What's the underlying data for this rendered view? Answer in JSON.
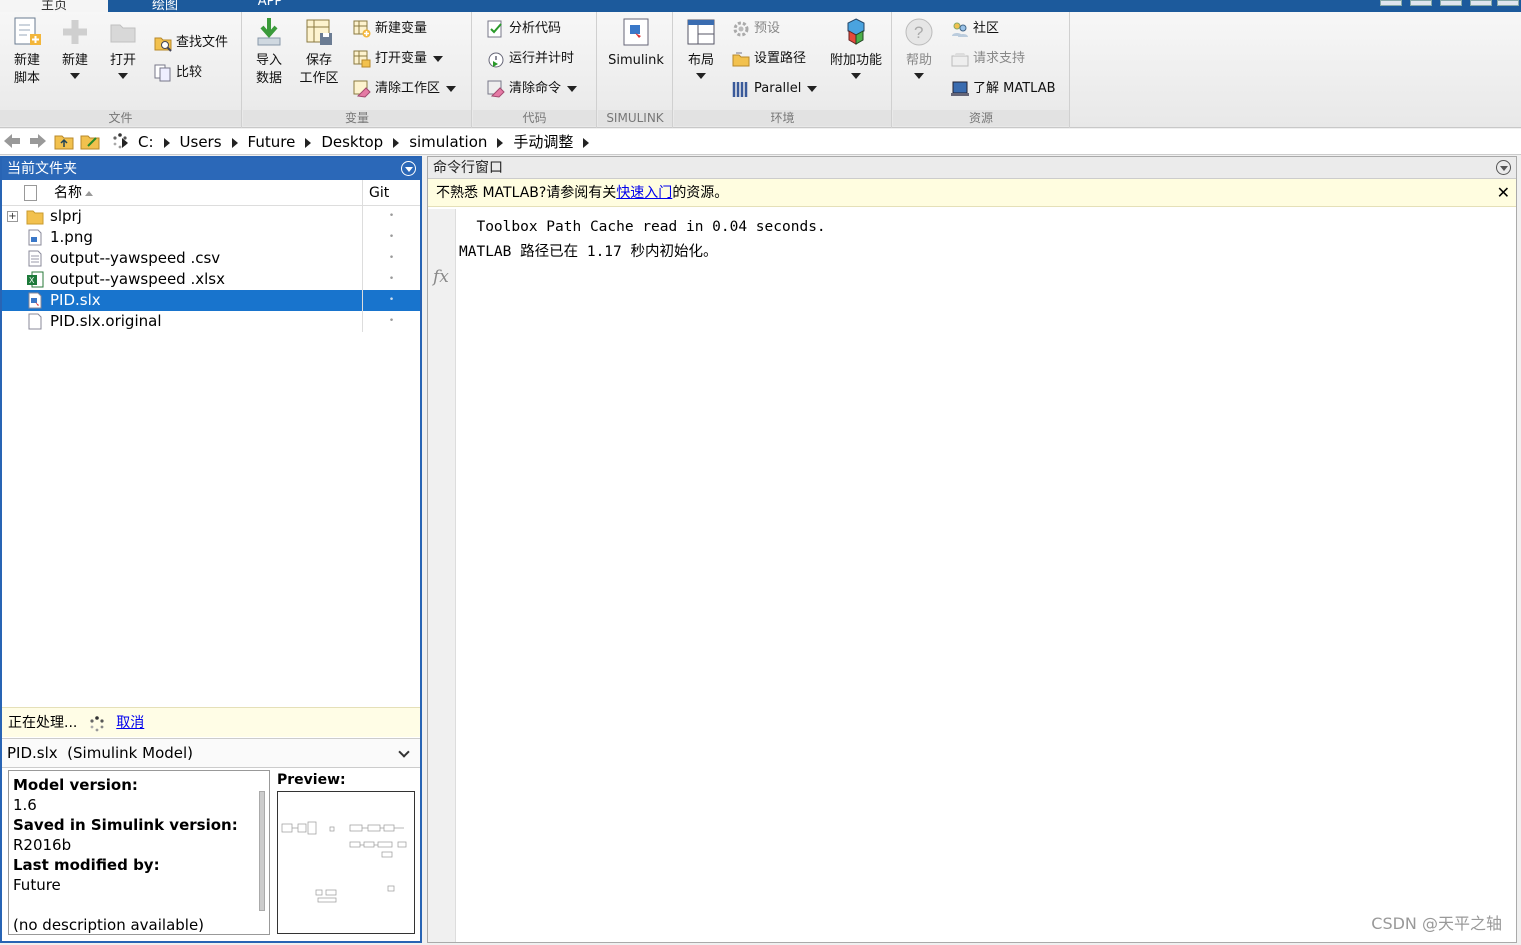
{
  "tabs": [
    {
      "label": "主页",
      "active": true
    },
    {
      "label": "绘图",
      "active": false
    },
    {
      "label": "APP",
      "active": false
    }
  ],
  "ribbon": {
    "file": {
      "label": "文件",
      "new_script": "新建\n脚本",
      "new": "新建",
      "open": "打开",
      "find_files": "查找文件",
      "compare": "比较"
    },
    "variable": {
      "label": "变量",
      "import_data": "导入\n数据",
      "save_workspace": "保存\n工作区",
      "new_variable": "新建变量",
      "open_variable": "打开变量",
      "clear_workspace": "清除工作区"
    },
    "code": {
      "label": "代码",
      "analyze_code": "分析代码",
      "run_and_time": "运行并计时",
      "clear_commands": "清除命令"
    },
    "simulink": {
      "label": "SIMULINK",
      "simulink": "Simulink"
    },
    "environment": {
      "label": "环境",
      "layout": "布局",
      "preferences": "预设",
      "set_path": "设置路径",
      "parallel": "Parallel",
      "addons": "附加功能"
    },
    "resources": {
      "label": "资源",
      "help": "帮助",
      "community": "社区",
      "request_support": "请求支持",
      "learn_matlab": "了解 MATLAB"
    }
  },
  "address": {
    "crumbs": [
      "C:",
      "Users",
      "Future",
      "Desktop",
      "simulation",
      "手动调整"
    ]
  },
  "current_folder": {
    "title": "当前文件夹",
    "col_name": "名称",
    "col_git": "Git",
    "files": [
      {
        "name": "slprj",
        "type": "folder",
        "git": "•",
        "selected": false
      },
      {
        "name": "1.png",
        "type": "png",
        "git": "•",
        "selected": false
      },
      {
        "name": "output--yawspeed .csv",
        "type": "csv",
        "git": "•",
        "selected": false
      },
      {
        "name": "output--yawspeed .xlsx",
        "type": "xlsx",
        "git": "•",
        "selected": false
      },
      {
        "name": "PID.slx",
        "type": "slx",
        "git": "•",
        "selected": true
      },
      {
        "name": "PID.slx.original",
        "type": "file",
        "git": "•",
        "selected": false
      }
    ],
    "status_text": "正在处理...",
    "cancel_label": "取消",
    "detail_title": "PID.slx  (Simulink Model)",
    "details": {
      "model_version_label": "Model version:",
      "model_version": "1.6",
      "saved_in_label": "Saved in Simulink version:",
      "saved_in": "R2016b",
      "last_modified_label": "Last modified by:",
      "last_modified": "Future",
      "description": "(no description available)"
    },
    "preview_label": "Preview:"
  },
  "command_window": {
    "title": "命令行窗口",
    "hint_prefix": "不熟悉 MATLAB?请参阅有关",
    "hint_link": "快速入门",
    "hint_suffix": "的资源。",
    "close_label": "✕",
    "lines": [
      "  Toolbox Path Cache read in 0.04 seconds.",
      "MATLAB 路径已在 1.17 秒内初始化。"
    ],
    "fx_label": "fx"
  },
  "watermark": "CSDN @天平之轴",
  "colors": {
    "title_blue": "#2b68b8",
    "selection": "#1874cd",
    "hint_bg": "#fffde0"
  }
}
